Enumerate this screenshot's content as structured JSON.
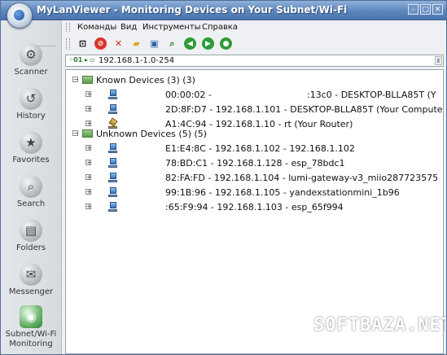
{
  "window": {
    "title": "MyLanViewer - Monitoring Devices on Your Subnet/Wi-Fi"
  },
  "title_buttons": {
    "minimize": "–",
    "maximize": "□",
    "close": "✕"
  },
  "sidebar": {
    "items": [
      {
        "label": "Scanner",
        "icon": "scanner-icon",
        "glyph": "⚙"
      },
      {
        "label": "History",
        "icon": "history-icon",
        "glyph": "↺"
      },
      {
        "label": "Favorites",
        "icon": "favorites-icon",
        "glyph": "★"
      },
      {
        "label": "Search",
        "icon": "search-icon",
        "glyph": "⌕"
      },
      {
        "label": "Folders",
        "icon": "folders-icon",
        "glyph": "▤"
      },
      {
        "label": "Messenger",
        "icon": "messenger-icon",
        "glyph": "✉"
      },
      {
        "label": "Subnet/Wi-Fi",
        "label2": "Monitoring",
        "icon": "subnet-monitoring-icon",
        "glyph": "◉"
      }
    ]
  },
  "menubar": {
    "items": [
      "Команды",
      "Вид",
      "Инструменты",
      "Справка"
    ]
  },
  "toolbar": {
    "buttons": [
      {
        "name": "new-scan-icon",
        "glyph": "⊡",
        "color": "#3a3a3a"
      },
      {
        "name": "stop-icon",
        "glyph": "⊘",
        "color": "#d8342a"
      },
      {
        "name": "delete-icon",
        "glyph": "✕",
        "color": "#d02a1e"
      },
      {
        "name": "open-folder-icon",
        "glyph": "▰",
        "color": "#d7a629"
      },
      {
        "name": "save-icon",
        "glyph": "▣",
        "color": "#2d5fa8"
      },
      {
        "name": "find-icon",
        "glyph": "⌕",
        "color": "#2b7a2b"
      },
      {
        "name": "back-icon",
        "glyph": "◀",
        "color": "#2e9b3b"
      },
      {
        "name": "forward-icon",
        "glyph": "▶",
        "color": "#2e9b3b"
      },
      {
        "name": "refresh-icon",
        "glyph": "●",
        "color": "#2e9b3b"
      }
    ]
  },
  "address": {
    "prefix": "01",
    "range": "192.168.1-1.0-254",
    "scroll_glyph": "⇕"
  },
  "tree": {
    "groups": [
      {
        "label": "Known Devices (3) (3)",
        "expander": "−",
        "items": [
          {
            "text": "00:00:02 -",
            "text2": ":13c0 - DESKTOP-BLLA85T (Y",
            "icon": "computer"
          },
          {
            "text": "2D:8F:D7 - 192.168.1.101 - DESKTOP-BLLA85T (Your Compute",
            "icon": "computer"
          },
          {
            "text": "A1:4C:94 - 192.168.1.10 - rt (Your Router)",
            "icon": "router"
          }
        ]
      },
      {
        "label": "Unknown Devices (5) (5)",
        "expander": "−",
        "items": [
          {
            "text": "E1:E4:8C - 192.168.1.102 - 192.168.1.102",
            "icon": "computer"
          },
          {
            "text": "78:BD:C1 - 192.168.1.128 - esp_78bdc1",
            "icon": "computer"
          },
          {
            "text": "82:FA:FD - 192.168.1.104 - lumi-gateway-v3_miio287723575",
            "icon": "computer"
          },
          {
            "text": "99:1B:96 - 192.168.1.105 - yandexstationmini_1b96",
            "icon": "computer"
          },
          {
            "text": ":65:F9:94 - 192.168.1.103 - esp_65f994",
            "icon": "computer"
          }
        ]
      }
    ],
    "child_expander": "+"
  },
  "watermark": "SOFTBAZA.NET"
}
